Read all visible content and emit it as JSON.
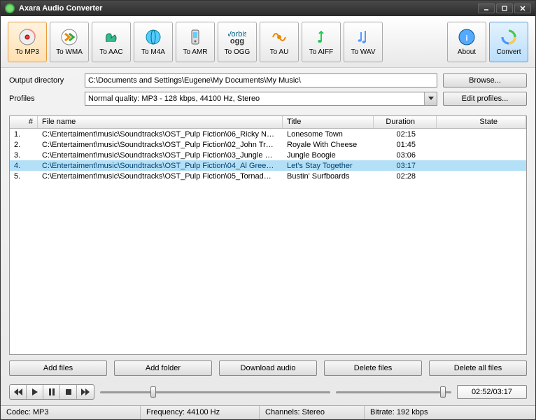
{
  "titlebar": {
    "text": "Axara Audio Converter"
  },
  "toolbar": {
    "buttons": [
      {
        "label": "To MP3",
        "name": "to-mp3",
        "icon": "disc",
        "active": true
      },
      {
        "label": "To WMA",
        "name": "to-wma",
        "icon": "wma"
      },
      {
        "label": "To AAC",
        "name": "to-aac",
        "icon": "aac"
      },
      {
        "label": "To M4A",
        "name": "to-m4a",
        "icon": "m4a"
      },
      {
        "label": "To AMR",
        "name": "to-amr",
        "icon": "amr"
      },
      {
        "label": "To OGG",
        "name": "to-ogg",
        "icon": "ogg"
      },
      {
        "label": "To AU",
        "name": "to-au",
        "icon": "au"
      },
      {
        "label": "To AIFF",
        "name": "to-aiff",
        "icon": "aiff"
      },
      {
        "label": "To WAV",
        "name": "to-wav",
        "icon": "wav"
      }
    ],
    "about": "About",
    "convert": "Convert"
  },
  "form": {
    "output_label": "Output directory",
    "output_value": "C:\\Documents and Settings\\Eugene\\My Documents\\My Music\\",
    "browse": "Browse...",
    "profiles_label": "Profiles",
    "profile_value": "Normal quality: MP3 - 128 kbps, 44100 Hz, Stereo",
    "edit_profiles": "Edit profiles..."
  },
  "table": {
    "headers": {
      "num": "#",
      "fname": "File name",
      "title": "Title",
      "dur": "Duration",
      "state": "State"
    },
    "rows": [
      {
        "num": "1.",
        "fname": "C:\\Entertaiment\\music\\Soundtracks\\OST_Pulp Fiction\\06_Ricky N…",
        "title": "Lonesome Town",
        "dur": "02:15",
        "state": "",
        "selected": false
      },
      {
        "num": "2.",
        "fname": "C:\\Entertaiment\\music\\Soundtracks\\OST_Pulp Fiction\\02_John Tr…",
        "title": "Royale With Cheese",
        "dur": "01:45",
        "state": "",
        "selected": false
      },
      {
        "num": "3.",
        "fname": "C:\\Entertaiment\\music\\Soundtracks\\OST_Pulp Fiction\\03_Jungle …",
        "title": "Jungle Boogie",
        "dur": "03:06",
        "state": "",
        "selected": false
      },
      {
        "num": "4.",
        "fname": "C:\\Entertaiment\\music\\Soundtracks\\OST_Pulp Fiction\\04_Al Gree…",
        "title": "Let's Stay Together",
        "dur": "03:17",
        "state": "",
        "selected": true
      },
      {
        "num": "5.",
        "fname": "C:\\Entertaiment\\music\\Soundtracks\\OST_Pulp Fiction\\05_Tornad…",
        "title": "Bustin' Surfboards",
        "dur": "02:28",
        "state": "",
        "selected": false
      }
    ]
  },
  "bottom": {
    "add_files": "Add files",
    "add_folder": "Add folder",
    "download_audio": "Download audio",
    "delete_files": "Delete files",
    "delete_all": "Delete all files"
  },
  "player": {
    "time": "02:52/03:17",
    "pos_pct": 22,
    "vol_pct": 90
  },
  "status": {
    "codec_label": "Codec:",
    "codec": "MP3",
    "freq_label": "Frequency:",
    "freq": "44100 Hz",
    "channels_label": "Channels:",
    "channels": "Stereo",
    "bitrate_label": "Bitrate:",
    "bitrate": "192 kbps"
  }
}
